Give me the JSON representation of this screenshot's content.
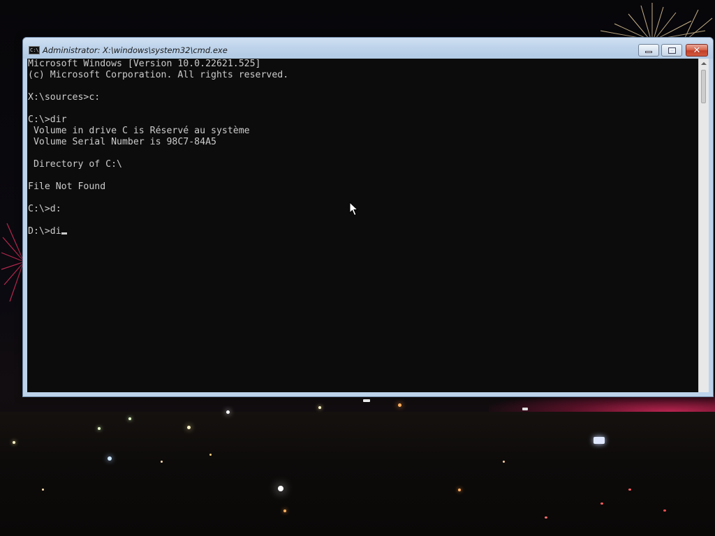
{
  "window": {
    "title": "Administrator: X:\\windows\\system32\\cmd.exe",
    "icon": "console-icon",
    "icon_text": "C:\\",
    "controls": {
      "minimize_icon": "minimize-icon",
      "maximize_icon": "restore-icon",
      "close_label": "✕"
    }
  },
  "console": {
    "background_color": "#0c0c0c",
    "text_color": "#cccccc",
    "lines": [
      "Microsoft Windows [Version 10.0.22621.525]",
      "(c) Microsoft Corporation. All rights reserved.",
      "",
      "X:\\sources>c:",
      "",
      "C:\\>dir",
      " Volume in drive C is Réservé au système",
      " Volume Serial Number is 98C7-84A5",
      "",
      " Directory of C:\\",
      "",
      "File Not Found",
      "",
      "C:\\>d:",
      ""
    ],
    "current_prompt": "D:\\>",
    "current_input": "di"
  },
  "desktop": {
    "wallpaper": "night-city-fireworks",
    "accent_color": "#d6285a"
  }
}
